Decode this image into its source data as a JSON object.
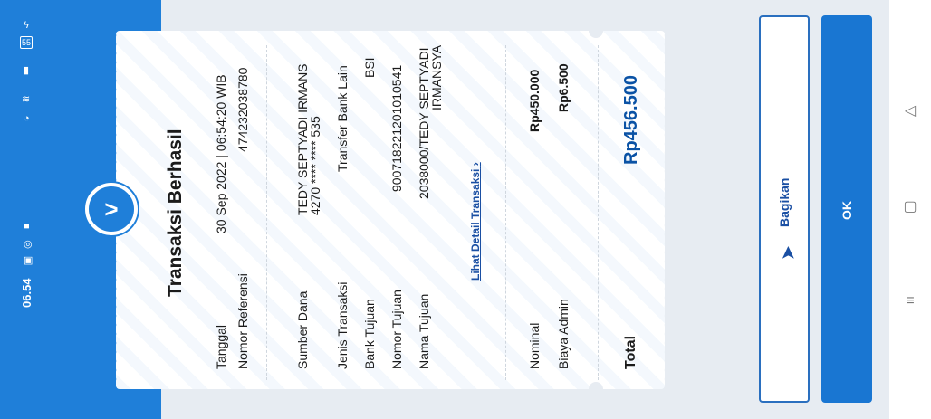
{
  "status": {
    "time": "06.54",
    "battery": "55"
  },
  "receipt": {
    "title": "Transaksi Berhasil",
    "rows_top": [
      {
        "label": "Tanggal",
        "value": "30 Sep 2022 | 06:54:20 WIB"
      },
      {
        "label": "Nomor Referensi",
        "value": "474232038780"
      }
    ],
    "rows_mid": [
      {
        "label": "Sumber Dana",
        "value_line1": "TEDY SEPTYADI IRMANS",
        "value_line2": "4270 **** **** 535"
      },
      {
        "label": "Jenis Transaksi",
        "value": "Transfer Bank Lain"
      },
      {
        "label": "Bank Tujuan",
        "value": "BSI"
      },
      {
        "label": "Nomor Tujuan",
        "value": "900718221201010541"
      },
      {
        "label": "Nama Tujuan",
        "value_line1": "2038000/TEDY SEPTYADI",
        "value_line2": "IRMANSYA"
      }
    ],
    "detail_link": "Lihat Detail Transaksi",
    "rows_fee": [
      {
        "label": "Nominal",
        "value": "Rp450.000"
      },
      {
        "label": "Biaya Admin",
        "value": "Rp6.500"
      }
    ],
    "total_label": "Total",
    "total_value": "Rp456.500"
  },
  "actions": {
    "share_label": "Bagikan",
    "ok_label": "OK"
  },
  "colors": {
    "brand": "#1f7fd9",
    "total": "#0a52a5",
    "ok_button": "#1976d2"
  }
}
